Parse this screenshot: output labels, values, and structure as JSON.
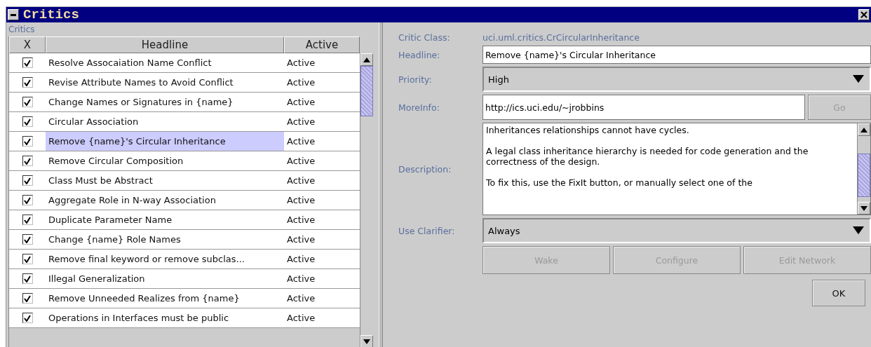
{
  "window": {
    "title": "Critics"
  },
  "panel_label": "Critics",
  "table": {
    "columns": [
      "X",
      "Headline",
      "Active"
    ],
    "rows": [
      {
        "checked": true,
        "headline": "Resolve Assocaiation Name Conflict",
        "active": "Active",
        "selected": false
      },
      {
        "checked": true,
        "headline": "Revise Attribute Names to Avoid Conflict",
        "active": "Active",
        "selected": false
      },
      {
        "checked": true,
        "headline": "Change Names or Signatures in {name}",
        "active": "Active",
        "selected": false
      },
      {
        "checked": true,
        "headline": "Circular Association",
        "active": "Active",
        "selected": false
      },
      {
        "checked": true,
        "headline": "Remove {name}'s Circular Inheritance",
        "active": "Active",
        "selected": true
      },
      {
        "checked": true,
        "headline": "Remove Circular Composition",
        "active": "Active",
        "selected": false
      },
      {
        "checked": true,
        "headline": "Class Must be Abstract",
        "active": "Active",
        "selected": false
      },
      {
        "checked": true,
        "headline": "Aggregate Role in N-way Association",
        "active": "Active",
        "selected": false
      },
      {
        "checked": true,
        "headline": "Duplicate Parameter Name",
        "active": "Active",
        "selected": false
      },
      {
        "checked": true,
        "headline": "Change {name} Role Names",
        "active": "Active",
        "selected": false
      },
      {
        "checked": true,
        "headline": "Remove final keyword or remove subclas...",
        "active": "Active",
        "selected": false
      },
      {
        "checked": true,
        "headline": "Illegal Generalization",
        "active": "Active",
        "selected": false
      },
      {
        "checked": true,
        "headline": "Remove Unneeded Realizes from {name}",
        "active": "Active",
        "selected": false
      },
      {
        "checked": true,
        "headline": "Operations in Interfaces must be public",
        "active": "Active",
        "selected": false
      }
    ]
  },
  "details": {
    "critic_class_label": "Critic Class:",
    "critic_class": "uci.uml.critics.CrCircularInheritance",
    "fields": [
      {
        "kind": "text",
        "label": "Headline:",
        "value": "Remove {name}'s Circular Inheritance"
      },
      {
        "kind": "select",
        "label": "Priority:",
        "value": "High"
      },
      {
        "kind": "link",
        "label": "MoreInfo:",
        "value": "http://ics.uci.edu/~jrobbins",
        "button": {
          "label": "Go",
          "disabled": true
        }
      },
      {
        "kind": "textarea",
        "label": "Description:",
        "paragraphs": [
          "Inheritances relationships cannot have cycles.",
          "A legal class inheritance hierarchy is needed for code generation and the correctness of the design.",
          "To fix this, use the FixIt button, or manually select one of the"
        ]
      },
      {
        "kind": "select",
        "label": "Use Clarifier:",
        "value": "Always"
      }
    ],
    "buttons": [
      {
        "label": "Wake",
        "disabled": true
      },
      {
        "label": "Configure",
        "disabled": true
      },
      {
        "label": "Edit Network",
        "disabled": true
      }
    ]
  },
  "ok_button": {
    "label": "OK",
    "disabled": false
  }
}
